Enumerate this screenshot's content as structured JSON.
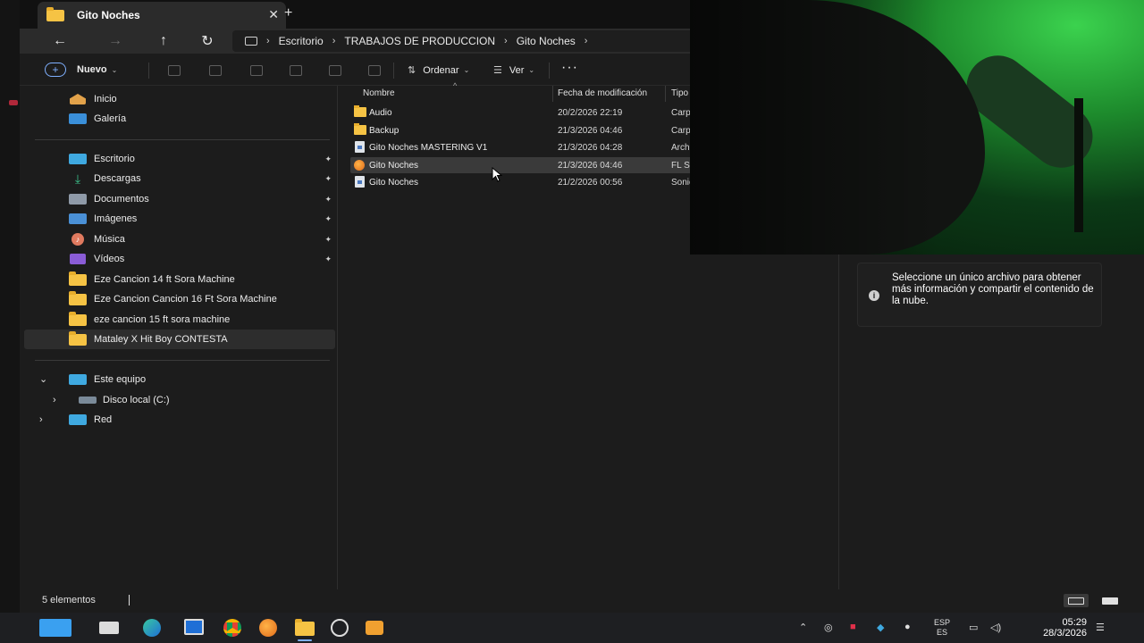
{
  "window": {
    "tab_title": "Gito Noches",
    "breadcrumb": [
      "Escritorio",
      "TRABAJOS DE PRODUCCION",
      "Gito Noches"
    ]
  },
  "toolbar": {
    "new_label": "Nuevo",
    "sort_label": "Ordenar",
    "view_label": "Ver",
    "more_label": "···"
  },
  "sidebar": {
    "home": "Inicio",
    "gallery": "Galería",
    "pinned": [
      "Escritorio",
      "Descargas",
      "Documentos",
      "Imágenes",
      "Música",
      "Vídeos"
    ],
    "folders": [
      "Eze Cancion 14 ft Sora Machine",
      "Eze Cancion Cancion 16 Ft Sora Machine",
      "eze cancion 15 ft sora machine",
      "Mataley X Hit Boy CONTESTA"
    ],
    "this_pc": "Este equipo",
    "local_disk": "Disco local (C:)",
    "network": "Red"
  },
  "file_list": {
    "columns": [
      "Nombre",
      "Fecha de modificación",
      "Tipo"
    ],
    "rows": [
      {
        "name": "Audio",
        "date": "20/2/2026 22:19",
        "type": "Carp",
        "icon": "folder-icon"
      },
      {
        "name": "Backup",
        "date": "21/3/2026 04:46",
        "type": "Carp",
        "icon": "folder-icon"
      },
      {
        "name": "Gito Noches MASTERING V1",
        "date": "21/3/2026 04:28",
        "type": "Arch",
        "icon": "audio-file-icon"
      },
      {
        "name": "Gito Noches",
        "date": "21/3/2026 04:46",
        "type": "FL St",
        "icon": "fl-studio-icon"
      },
      {
        "name": "Gito Noches",
        "date": "21/2/2026 00:56",
        "type": "Sonic",
        "icon": "audio-file-icon"
      }
    ]
  },
  "details": {
    "info_text": "Seleccione un único archivo para obtener más información y compartir el contenido de la nube."
  },
  "status": {
    "count": "5 elementos"
  },
  "taskbar": {
    "lang_top": "ESP",
    "lang_bottom": "ES",
    "time": "05:29",
    "date": "28/3/2026"
  },
  "colors": {
    "accent": "#7fb0ff",
    "folder": "#f6c344",
    "window_bg": "#1c1c1c"
  }
}
